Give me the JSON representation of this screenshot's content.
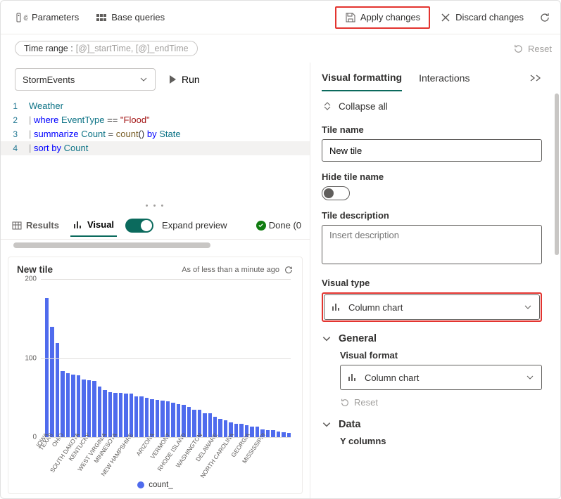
{
  "toolbar": {
    "parameters": "Parameters",
    "base_queries": "Base queries",
    "apply_changes": "Apply changes",
    "discard_changes": "Discard changes"
  },
  "time_range": {
    "label": "Time range :",
    "value": "[@]_startTime, [@]_endTime"
  },
  "reset_label": "Reset",
  "datasource": {
    "selected": "StormEvents"
  },
  "run_label": "Run",
  "code": {
    "lines": [
      {
        "n": 1,
        "tokens": [
          {
            "c": "tok-table",
            "t": "Weather"
          }
        ]
      },
      {
        "n": 2,
        "tokens": [
          {
            "c": "tok-pipe",
            "t": "| "
          },
          {
            "c": "tok-kw",
            "t": "where"
          },
          {
            "c": "",
            "t": " "
          },
          {
            "c": "tok-col",
            "t": "EventType"
          },
          {
            "c": "",
            "t": " "
          },
          {
            "c": "tok-op",
            "t": "=="
          },
          {
            "c": "",
            "t": " "
          },
          {
            "c": "tok-str",
            "t": "\"Flood\""
          }
        ]
      },
      {
        "n": 3,
        "tokens": [
          {
            "c": "tok-pipe",
            "t": "| "
          },
          {
            "c": "tok-kw",
            "t": "summarize"
          },
          {
            "c": "",
            "t": " "
          },
          {
            "c": "tok-col",
            "t": "Count"
          },
          {
            "c": "",
            "t": " "
          },
          {
            "c": "tok-op",
            "t": "="
          },
          {
            "c": "",
            "t": " "
          },
          {
            "c": "tok-fn",
            "t": "count"
          },
          {
            "c": "",
            "t": "() "
          },
          {
            "c": "tok-kw",
            "t": "by"
          },
          {
            "c": "",
            "t": " "
          },
          {
            "c": "tok-col",
            "t": "State"
          }
        ]
      },
      {
        "n": 4,
        "tokens": [
          {
            "c": "tok-pipe",
            "t": "| "
          },
          {
            "c": "tok-kw",
            "t": "sort by"
          },
          {
            "c": "",
            "t": " "
          },
          {
            "c": "tok-col",
            "t": "Count"
          }
        ]
      }
    ],
    "highlight_line": 4
  },
  "result_tabs": {
    "results": "Results",
    "visual": "Visual",
    "expand_preview": "Expand preview",
    "done": "Done (0"
  },
  "tile": {
    "title": "New tile",
    "as_of": "As of less than a minute ago"
  },
  "legend_label": "count_",
  "right": {
    "tabs": {
      "visual_formatting": "Visual formatting",
      "interactions": "Interactions"
    },
    "collapse_all": "Collapse all",
    "tile_name_label": "Tile name",
    "tile_name_value": "New tile",
    "hide_tile_name_label": "Hide tile name",
    "tile_description_label": "Tile description",
    "tile_description_placeholder": "Insert description",
    "visual_type_label": "Visual type",
    "visual_type_value": "Column chart",
    "general": "General",
    "visual_format_label": "Visual format",
    "visual_format_value": "Column chart",
    "reset": "Reset",
    "data": "Data",
    "y_columns": "Y columns"
  },
  "chart_data": {
    "type": "bar",
    "title": "New tile",
    "ylabel": "",
    "xlabel": "",
    "ylim": [
      0,
      200
    ],
    "yticks": [
      0,
      100,
      200
    ],
    "series": [
      {
        "name": "count_",
        "values": [
          176,
          140,
          119,
          84,
          81,
          79,
          78,
          73,
          72,
          71,
          64,
          60,
          57,
          56,
          56,
          55,
          55,
          52,
          52,
          50,
          48,
          47,
          46,
          45,
          44,
          42,
          41,
          38,
          35,
          35,
          30,
          30,
          26,
          23,
          21,
          19,
          17,
          17,
          15,
          13,
          13,
          10,
          9,
          9,
          7,
          6,
          5
        ]
      }
    ],
    "categories_labeled": [
      {
        "i": 0,
        "l": "IOWA"
      },
      {
        "i": 1,
        "l": "TEXAS"
      },
      {
        "i": 3,
        "l": "OHIO"
      },
      {
        "i": 6,
        "l": "SOUTH DAKOTA"
      },
      {
        "i": 8,
        "l": "KENTUCKY"
      },
      {
        "i": 11,
        "l": "WEST VIRGINIA"
      },
      {
        "i": 13,
        "l": "MINNESOTA"
      },
      {
        "i": 16,
        "l": "NEW HAMPSHIRE"
      },
      {
        "i": 20,
        "l": "ARIZONA"
      },
      {
        "i": 23,
        "l": "VERMONT"
      },
      {
        "i": 26,
        "l": "RHODE ISLAND"
      },
      {
        "i": 29,
        "l": "WASHINGTON"
      },
      {
        "i": 32,
        "l": "DELAWARE"
      },
      {
        "i": 35,
        "l": "NORTH CAROLINA"
      },
      {
        "i": 38,
        "l": "GEORGIA"
      },
      {
        "i": 41,
        "l": "MISSISSIPPI"
      }
    ]
  }
}
